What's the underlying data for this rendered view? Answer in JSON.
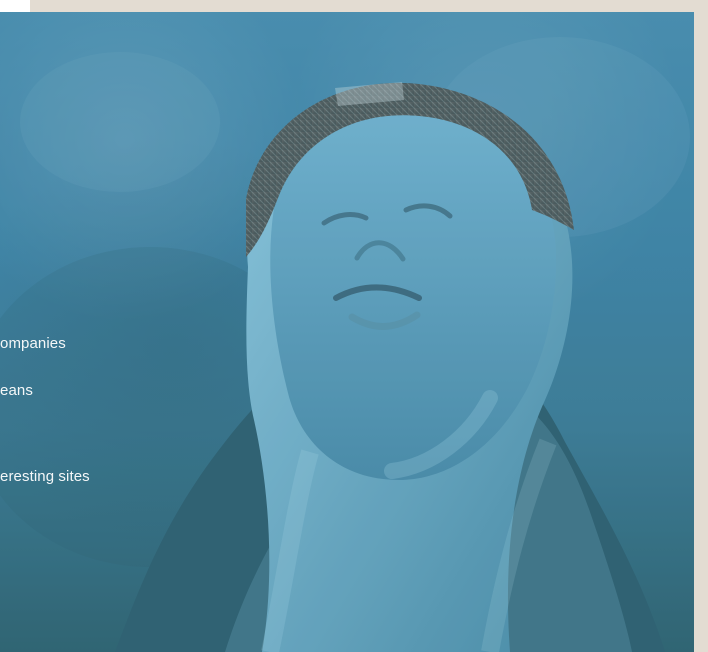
{
  "hero": {
    "text_lines": [
      "ompanies",
      "eans",
      "eresting sites"
    ]
  }
}
